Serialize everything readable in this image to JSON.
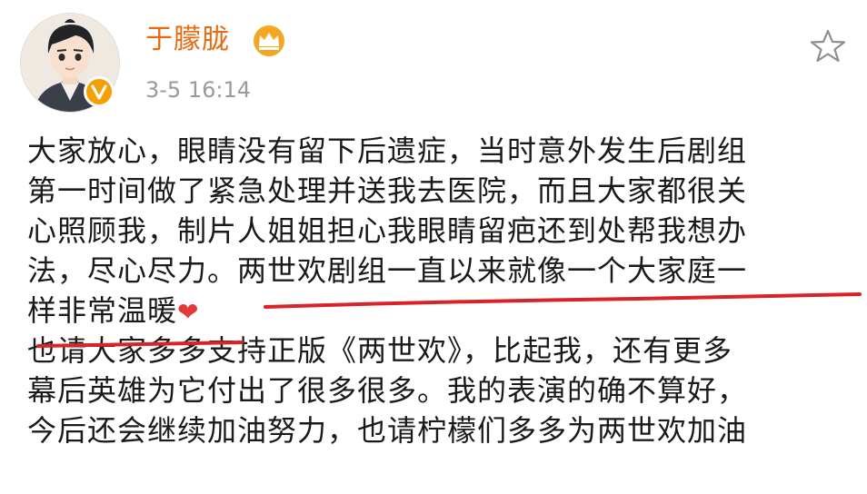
{
  "post": {
    "username": "于朦胧",
    "timestamp": "3-5 16:14",
    "lines": [
      "大家放心，眼睛没有留下后遗症，当时意外发生后剧组",
      "第一时间做了紧急处理并送我去医院，而且大家都很关",
      "心照顾我，制片人姐姐担心我眼睛留疤还到处帮我想办",
      "法，尽心尽力。",
      "两世欢剧组一直以来就像一个大家庭一",
      "样非常温暖",
      "也请大家多多支持正版《两世欢》，比起我，还有更多",
      "幕后英雄为它付出了很多很多。我的表演的确不算好，",
      "今后还会继续加油努力，也请柠檬们多多为两世欢加油"
    ],
    "emoji": "❤"
  },
  "colors": {
    "username": "#e86a10",
    "timestamp": "#9a9a9a",
    "underline": "#d8232a",
    "verified": "#f59f00",
    "crown": "#f5a623"
  },
  "icons": {
    "avatar": "avatar-cartoon-man",
    "verified": "verified-v-badge-icon",
    "crown": "crown-icon",
    "favorite": "star-outline-icon"
  }
}
